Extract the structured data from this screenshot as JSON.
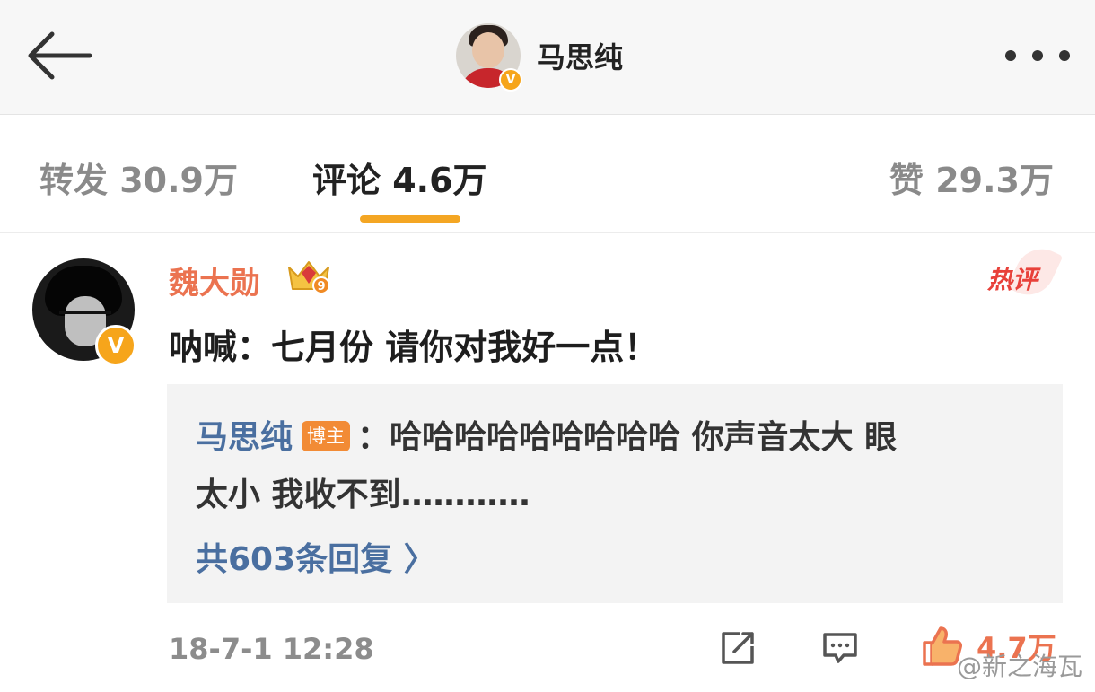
{
  "header": {
    "title": "马思纯",
    "verified_badge": "V",
    "back_icon": "back-arrow-icon",
    "more_icon": "more-dots-icon"
  },
  "tabs": [
    {
      "label": "转发 30.9万",
      "active": false
    },
    {
      "label": "评论 4.6万",
      "active": true
    },
    {
      "label": "赞 29.3万",
      "active": false
    }
  ],
  "comment": {
    "author": "魏大勋",
    "verified_badge": "V",
    "level_badge": "9",
    "hot_tag": "热评",
    "text": "呐喊：七月份 请你对我好一点！",
    "reply": {
      "author": "马思纯",
      "author_tag": "博主",
      "line1_rest": "：哈哈哈哈哈哈哈哈哈 你声音太大 眼",
      "line2": "太小 我收不到…………",
      "more_label": "共603条回复 〉"
    },
    "time": "18-7-1 12:28",
    "like_count": "4.7万"
  },
  "watermark": "@新之海瓦",
  "colors": {
    "accent": "#f4a623",
    "username": "#eb7350",
    "link": "#4a6fa0",
    "hot": "#e8413a",
    "verified": "#f6a51b"
  }
}
